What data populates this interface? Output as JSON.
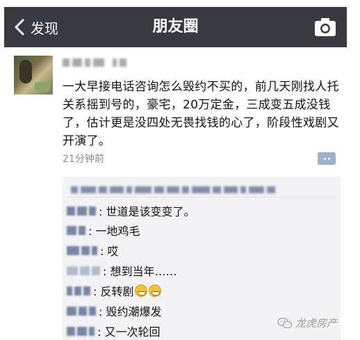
{
  "nav": {
    "back_label": "发现",
    "title": "朋友圈",
    "back_icon": "chevron-left-icon",
    "camera_icon": "camera-icon"
  },
  "post": {
    "text": "一大早接电话咨询怎么毁约不买的，前几天刚找人托关系摇到号的，豪宅，20万定金，三成变五成没钱了，估计更是没四处无畏找钱的心了，阶段性戏剧又开演了。",
    "time": "21分钟前"
  },
  "comments": [
    {
      "text": ": 世道是该变变了。"
    },
    {
      "text": ": 一地鸡毛"
    },
    {
      "text": ": 哎"
    },
    {
      "text": ": 想到当年……"
    },
    {
      "text": ": 反转剧",
      "emoji": "grinning-face-icon"
    },
    {
      "text": ": 毁约潮爆发"
    },
    {
      "text": ": 又一次轮回"
    }
  ],
  "watermark": {
    "text": "龙虎房产",
    "icon": "wechat-icon"
  },
  "colors": {
    "nav_bg": "#393a3f",
    "comment_bg": "#f3f3f5",
    "link_blue": "#5a6a90"
  }
}
